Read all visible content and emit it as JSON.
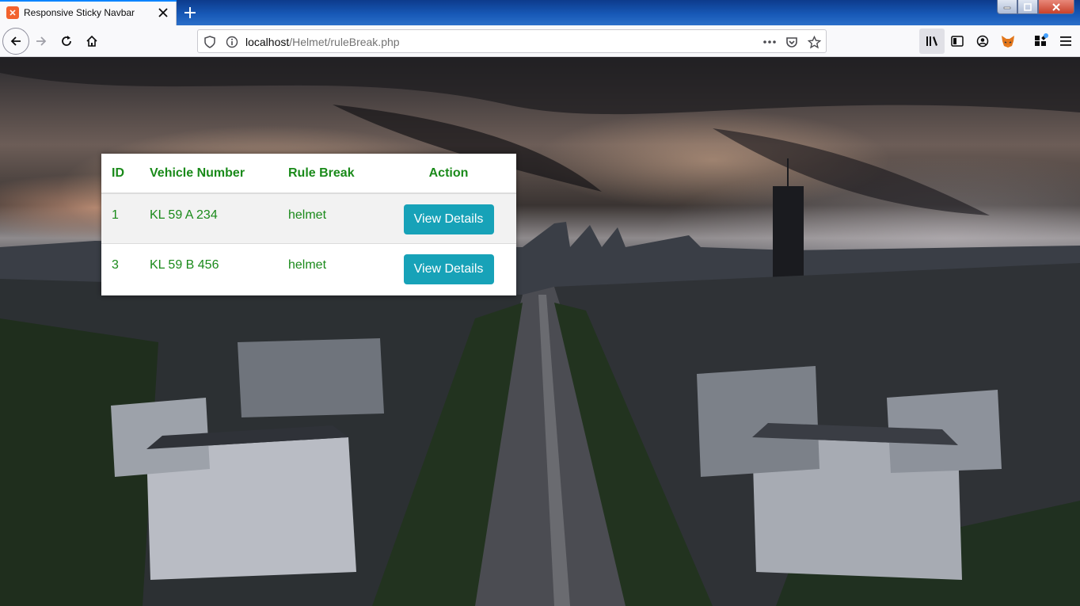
{
  "browser": {
    "tab_title": "Responsive Sticky Navbar",
    "url_host": "localhost",
    "url_path": "/Helmet/ruleBreak.php",
    "icons": {
      "favicon": "xampp-icon",
      "tab_close": "close-icon",
      "new_tab": "plus-icon",
      "back": "back-arrow-icon",
      "forward": "forward-arrow-icon",
      "reload": "reload-icon",
      "home": "home-icon",
      "shield": "shield-icon",
      "info": "info-icon",
      "more": "more-icon",
      "pocket": "pocket-icon",
      "bookmark": "star-icon",
      "library": "library-icon",
      "sidebar": "sidebar-icon",
      "account": "account-icon",
      "metamask": "fox-icon",
      "extensions": "extensions-icon",
      "menu": "menu-icon"
    }
  },
  "table": {
    "headers": {
      "id": "ID",
      "vehicle_number": "Vehicle Number",
      "rule_break": "Rule Break",
      "action": "Action"
    },
    "rows": [
      {
        "id": "1",
        "vehicle_number": "KL 59 A 234",
        "rule_break": "helmet",
        "button": "View Details"
      },
      {
        "id": "3",
        "vehicle_number": "KL 59 B 456",
        "rule_break": "helmet",
        "button": "View Details"
      }
    ]
  },
  "colors": {
    "header_text": "#1a8a1a",
    "button_bg": "#17a2b8",
    "button_text": "#ffffff"
  }
}
